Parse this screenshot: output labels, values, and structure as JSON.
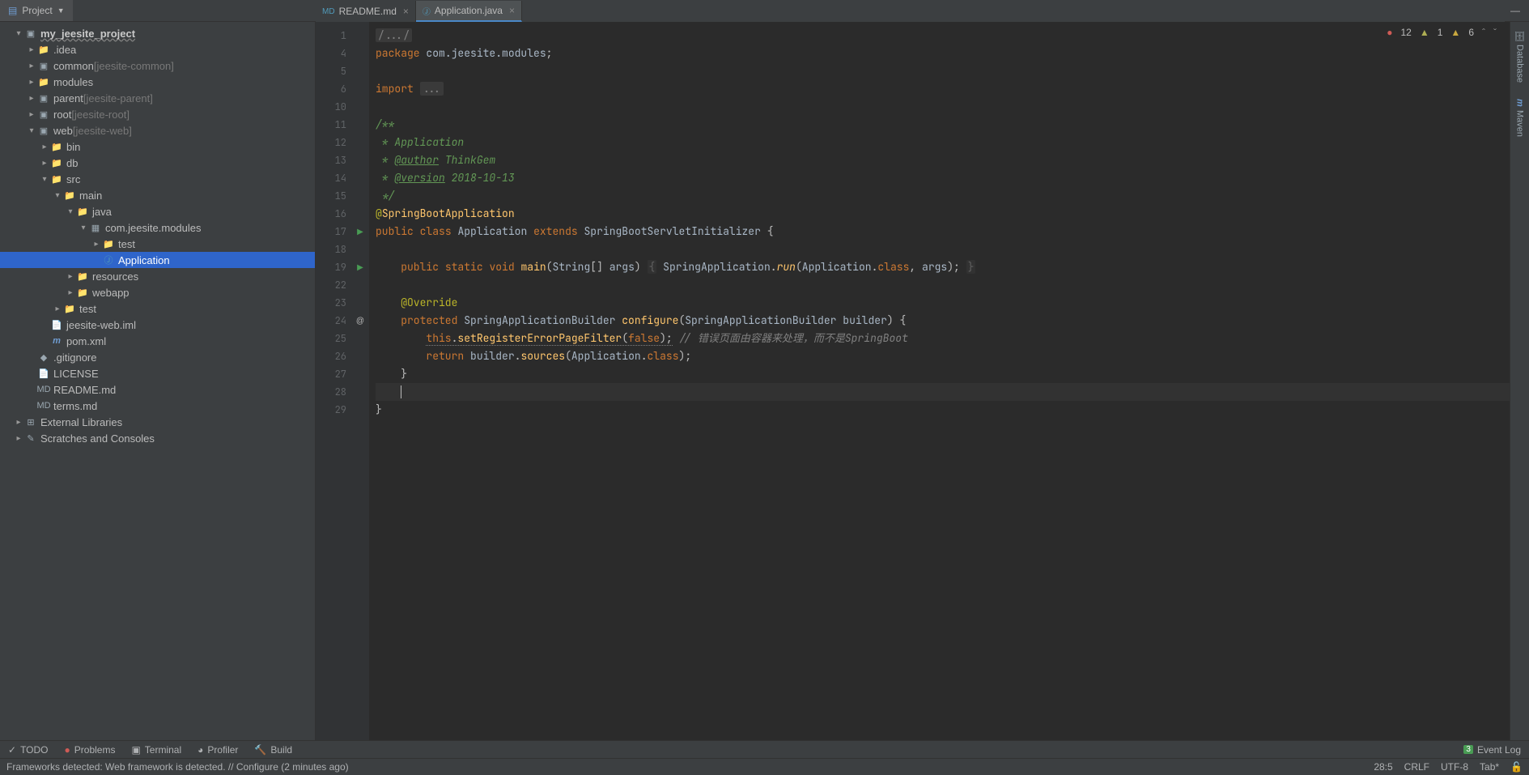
{
  "topbar": {
    "project_label": "Project"
  },
  "tabs": [
    {
      "icon": "md",
      "label": "README.md",
      "active": false,
      "closable": true
    },
    {
      "icon": "java",
      "label": "Application.java",
      "active": true,
      "closable": true
    }
  ],
  "inspections": {
    "errors": "12",
    "warnings": "1",
    "weak": "6"
  },
  "tree": {
    "root": "my_jeesite_project",
    "items": [
      {
        "d": 1,
        "ch": "v",
        "i": "module",
        "t": "my_jeesite_project",
        "bold": true
      },
      {
        "d": 2,
        "ch": ">",
        "i": "folder",
        "t": ".idea"
      },
      {
        "d": 2,
        "ch": ">",
        "i": "module",
        "t": "common",
        "suf": "[jeesite-common]"
      },
      {
        "d": 2,
        "ch": ">",
        "i": "folder",
        "t": "modules"
      },
      {
        "d": 2,
        "ch": ">",
        "i": "module",
        "t": "parent",
        "suf": "[jeesite-parent]"
      },
      {
        "d": 2,
        "ch": ">",
        "i": "module",
        "t": "root",
        "suf": "[jeesite-root]"
      },
      {
        "d": 2,
        "ch": "v",
        "i": "module",
        "t": "web",
        "suf": "[jeesite-web]"
      },
      {
        "d": 3,
        "ch": ">",
        "i": "folder",
        "t": "bin"
      },
      {
        "d": 3,
        "ch": ">",
        "i": "folder",
        "t": "db"
      },
      {
        "d": 3,
        "ch": "v",
        "i": "folder-src",
        "t": "src"
      },
      {
        "d": 4,
        "ch": "v",
        "i": "folder-src",
        "t": "main"
      },
      {
        "d": 5,
        "ch": "v",
        "i": "folder-src",
        "t": "java"
      },
      {
        "d": 6,
        "ch": "v",
        "i": "package",
        "t": "com.jeesite.modules"
      },
      {
        "d": 7,
        "ch": ">",
        "i": "folder",
        "t": "test"
      },
      {
        "d": 7,
        "ch": "",
        "i": "java",
        "t": "Application",
        "selected": true
      },
      {
        "d": 5,
        "ch": ">",
        "i": "folder-res",
        "t": "resources"
      },
      {
        "d": 5,
        "ch": ">",
        "i": "folder",
        "t": "webapp"
      },
      {
        "d": 4,
        "ch": ">",
        "i": "folder",
        "t": "test"
      },
      {
        "d": 3,
        "ch": "",
        "i": "xml",
        "t": "jeesite-web.iml"
      },
      {
        "d": 3,
        "ch": "",
        "i": "maven",
        "t": "pom.xml"
      },
      {
        "d": 2,
        "ch": "",
        "i": "git",
        "t": ".gitignore"
      },
      {
        "d": 2,
        "ch": "",
        "i": "file",
        "t": "LICENSE"
      },
      {
        "d": 2,
        "ch": "",
        "i": "md",
        "t": "README.md"
      },
      {
        "d": 2,
        "ch": "",
        "i": "md",
        "t": "terms.md"
      },
      {
        "d": 1,
        "ch": ">",
        "i": "lib",
        "t": "External Libraries"
      },
      {
        "d": 1,
        "ch": ">",
        "i": "scratch",
        "t": "Scratches and Consoles"
      }
    ]
  },
  "code": {
    "lines": [
      1,
      4,
      5,
      6,
      10,
      11,
      12,
      13,
      14,
      15,
      16,
      17,
      18,
      19,
      22,
      23,
      24,
      25,
      26,
      27,
      28,
      29
    ],
    "package": "package",
    "pkg_name": "com.jeesite.modules",
    "import": "import",
    "fold_dots": "...",
    "javadoc_open": "/**",
    "javadoc_star": " * ",
    "javadoc_close": " */",
    "doc_app": "Application",
    "doc_author_tag": "@author",
    "doc_author": "ThinkGem",
    "doc_version_tag": "@version",
    "doc_version": "2018-10-13",
    "sba": "SpringBootApplication",
    "public": "public",
    "class": "class",
    "extends": "extends",
    "static": "static",
    "void": "void",
    "return": "return",
    "protected": "protected",
    "this": "this",
    "Application": "Application",
    "SBSI": "SpringBootServletInitializer",
    "main": "main",
    "String": "String",
    "args": "args",
    "SpringApplication": "SpringApplication",
    "run": "run",
    "cls_kw": "class",
    "Override": "@Override",
    "SAB": "SpringApplicationBuilder",
    "configure": "configure",
    "builder": "builder",
    "setReg": "setRegisterErrorPageFilter",
    "false": "false",
    "comm": "// 错误页面由容器来处理，而不是SpringBoot",
    "sources": "sources"
  },
  "bottom": {
    "todo": "TODO",
    "problems": "Problems",
    "terminal": "Terminal",
    "profiler": "Profiler",
    "build": "Build",
    "eventlog": "Event Log",
    "event_count": "3"
  },
  "right": {
    "db": "Database",
    "maven": "Maven"
  },
  "status": {
    "msg": "Frameworks detected: Web framework is detected. // Configure (2 minutes ago)",
    "pos": "28:5",
    "sep": "CRLF",
    "enc": "UTF-8",
    "indent": "Tab*"
  }
}
